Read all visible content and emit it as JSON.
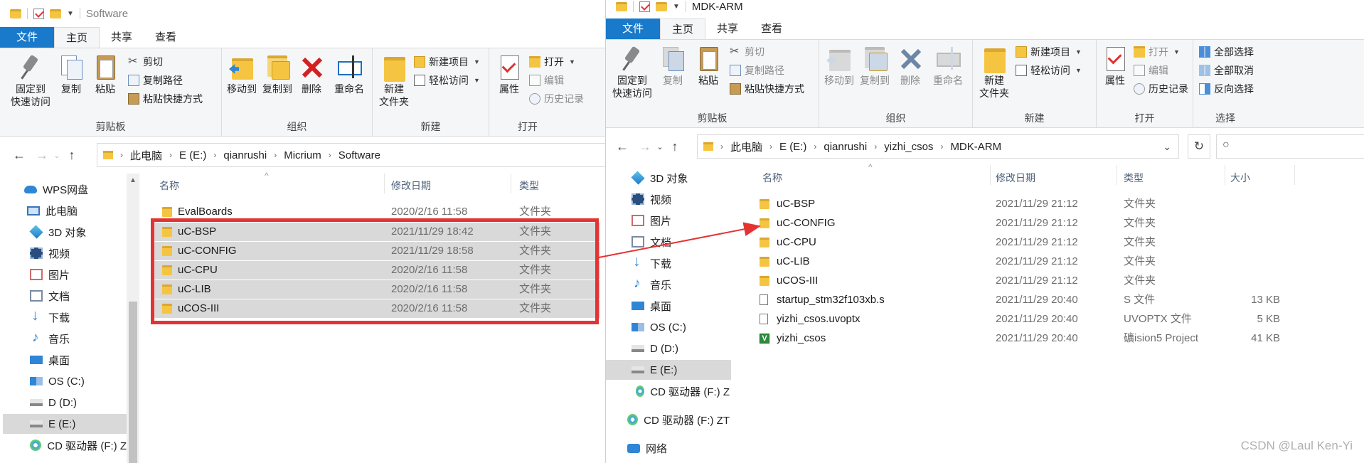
{
  "left": {
    "title": "Software",
    "tabs": [
      "文件",
      "主页",
      "共享",
      "查看"
    ],
    "ribbon": {
      "pin": "固定到\n快速访问",
      "copy": "复制",
      "paste": "粘贴",
      "cut": "剪切",
      "copy_path": "复制路径",
      "paste_shortcut": "粘贴快捷方式",
      "clipboard_label": "剪贴板",
      "move_to": "移动到",
      "copy_to": "复制到",
      "delete": "删除",
      "rename": "重命名",
      "organize_label": "组织",
      "new_folder": "新建\n文件夹",
      "new_item": "新建项目",
      "easy_access": "轻松访问",
      "new_label": "新建",
      "properties": "属性",
      "open": "打开",
      "edit": "编辑",
      "history": "历史记录",
      "open_label": "打开"
    },
    "breadcrumb": [
      "此电脑",
      "E (E:)",
      "qianrushi",
      "Micrium",
      "Software"
    ],
    "nav": [
      {
        "label": "WPS网盘",
        "icon": "cloud-icon"
      },
      {
        "label": "此电脑",
        "icon": "pc-icon"
      },
      {
        "label": "3D 对象",
        "icon": "3d-objects-icon"
      },
      {
        "label": "视频",
        "icon": "video-icon"
      },
      {
        "label": "图片",
        "icon": "pictures-icon"
      },
      {
        "label": "文档",
        "icon": "documents-icon"
      },
      {
        "label": "下载",
        "icon": "download-icon"
      },
      {
        "label": "音乐",
        "icon": "music-icon"
      },
      {
        "label": "桌面",
        "icon": "desktop-icon"
      },
      {
        "label": "OS (C:)",
        "icon": "os-drive-icon"
      },
      {
        "label": "D (D:)",
        "icon": "drive-icon"
      },
      {
        "label": "E (E:)",
        "icon": "drive-icon"
      },
      {
        "label": "CD 驱动器 (F:) Z",
        "icon": "cd-drive-icon"
      }
    ],
    "columns": [
      "名称",
      "修改日期",
      "类型"
    ],
    "files": [
      {
        "name": "EvalBoards",
        "date": "2020/2/16 11:58",
        "type": "文件夹"
      },
      {
        "name": "uC-BSP",
        "date": "2021/11/29 18:42",
        "type": "文件夹"
      },
      {
        "name": "uC-CONFIG",
        "date": "2021/11/29 18:58",
        "type": "文件夹"
      },
      {
        "name": "uC-CPU",
        "date": "2020/2/16 11:58",
        "type": "文件夹"
      },
      {
        "name": "uC-LIB",
        "date": "2020/2/16 11:58",
        "type": "文件夹"
      },
      {
        "name": "uCOS-III",
        "date": "2020/2/16 11:58",
        "type": "文件夹"
      }
    ]
  },
  "right": {
    "title": "MDK-ARM",
    "tabs": [
      "文件",
      "主页",
      "共享",
      "查看"
    ],
    "ribbon": {
      "pin": "固定到\n快速访问",
      "copy": "复制",
      "paste": "粘贴",
      "cut": "剪切",
      "copy_path": "复制路径",
      "paste_shortcut": "粘贴快捷方式",
      "clipboard_label": "剪贴板",
      "move_to": "移动到",
      "copy_to": "复制到",
      "delete": "删除",
      "rename": "重命名",
      "organize_label": "组织",
      "new_folder": "新建\n文件夹",
      "new_item": "新建项目",
      "easy_access": "轻松访问",
      "new_label": "新建",
      "properties": "属性",
      "open": "打开",
      "edit": "编辑",
      "history": "历史记录",
      "open_label": "打开",
      "select_all": "全部选择",
      "select_none": "全部取消",
      "invert_selection": "反向选择",
      "select_label": "选择"
    },
    "breadcrumb": [
      "此电脑",
      "E (E:)",
      "qianrushi",
      "yizhi_csos",
      "MDK-ARM"
    ],
    "nav": [
      {
        "label": "3D 对象",
        "icon": "3d-objects-icon"
      },
      {
        "label": "视频",
        "icon": "video-icon"
      },
      {
        "label": "图片",
        "icon": "pictures-icon"
      },
      {
        "label": "文档",
        "icon": "documents-icon"
      },
      {
        "label": "下载",
        "icon": "download-icon"
      },
      {
        "label": "音乐",
        "icon": "music-icon"
      },
      {
        "label": "桌面",
        "icon": "desktop-icon"
      },
      {
        "label": "OS (C:)",
        "icon": "os-drive-icon"
      },
      {
        "label": "D (D:)",
        "icon": "drive-icon"
      },
      {
        "label": "E (E:)",
        "icon": "drive-icon"
      },
      {
        "label": "CD 驱动器 (F:) Z",
        "icon": "cd-drive-icon"
      },
      {
        "label": "CD 驱动器 (F:) ZT",
        "icon": "cd-drive-icon"
      },
      {
        "label": "网络",
        "icon": "network-icon"
      }
    ],
    "columns": [
      "名称",
      "修改日期",
      "类型",
      "大小"
    ],
    "files": [
      {
        "name": "uC-BSP",
        "date": "2021/11/29 21:12",
        "type": "文件夹",
        "size": "",
        "icon": "folder"
      },
      {
        "name": "uC-CONFIG",
        "date": "2021/11/29 21:12",
        "type": "文件夹",
        "size": "",
        "icon": "folder"
      },
      {
        "name": "uC-CPU",
        "date": "2021/11/29 21:12",
        "type": "文件夹",
        "size": "",
        "icon": "folder"
      },
      {
        "name": "uC-LIB",
        "date": "2021/11/29 21:12",
        "type": "文件夹",
        "size": "",
        "icon": "folder"
      },
      {
        "name": "uCOS-III",
        "date": "2021/11/29 21:12",
        "type": "文件夹",
        "size": "",
        "icon": "folder"
      },
      {
        "name": "startup_stm32f103xb.s",
        "date": "2021/11/29 20:40",
        "type": "S 文件",
        "size": "13 KB",
        "icon": "file"
      },
      {
        "name": "yizhi_csos.uvoptx",
        "date": "2021/11/29 20:40",
        "type": "UVOPTX 文件",
        "size": "5 KB",
        "icon": "file"
      },
      {
        "name": "yizhi_csos",
        "date": "2021/11/29 20:40",
        "type": "礦ision5 Project",
        "size": "41 KB",
        "icon": "project"
      }
    ]
  },
  "watermark": "CSDN @Laul Ken-Yi",
  "colors": {
    "accent": "#1979ca",
    "highlight_box": "#e53333",
    "selection": "#d9d9d9"
  }
}
